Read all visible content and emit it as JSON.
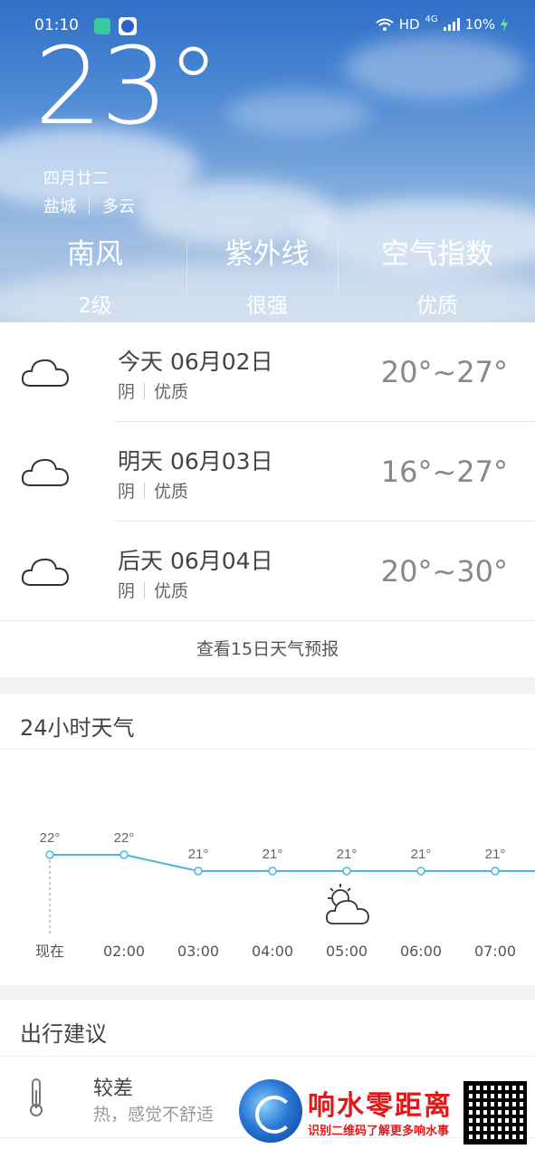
{
  "status_bar": {
    "time": "01:10",
    "network": "HD",
    "signal": "4G",
    "battery": "10%"
  },
  "current": {
    "temperature": "23°",
    "lunar_date": "四月廿二",
    "city": "盐城",
    "condition": "多云"
  },
  "stats": [
    {
      "title": "南风",
      "value": "2级"
    },
    {
      "title": "紫外线",
      "value": "很强"
    },
    {
      "title": "空气指数",
      "value": "优质"
    }
  ],
  "forecast": {
    "days": [
      {
        "date": "今天 06月02日",
        "condition": "阴",
        "air": "优质",
        "range": "20°~27°",
        "icon": "cloud-icon"
      },
      {
        "date": "明天 06月03日",
        "condition": "阴",
        "air": "优质",
        "range": "16°~27°",
        "icon": "cloud-icon"
      },
      {
        "date": "后天 06月04日",
        "condition": "阴",
        "air": "优质",
        "range": "20°~30°",
        "icon": "cloud-icon"
      }
    ],
    "more_label": "查看15日天气预报"
  },
  "hourly": {
    "title": "24小时天气",
    "chart_data": {
      "type": "line",
      "x": [
        "现在",
        "02:00",
        "03:00",
        "04:00",
        "05:00",
        "06:00",
        "07:00"
      ],
      "series": [
        {
          "values": [
            22,
            22,
            21,
            21,
            21,
            21,
            21
          ]
        }
      ],
      "value_labels": [
        "22°",
        "22°",
        "21°",
        "21°",
        "21°",
        "21°",
        "21°"
      ],
      "icon": "partly-cloudy-icon",
      "line_color": "#4cb8d8"
    }
  },
  "travel": {
    "title": "出行建议",
    "level": "较差",
    "description": "热，感觉不舒适"
  },
  "watermark": {
    "name": "响水零距离",
    "slogan": "识别二维码了解更多响水事"
  }
}
